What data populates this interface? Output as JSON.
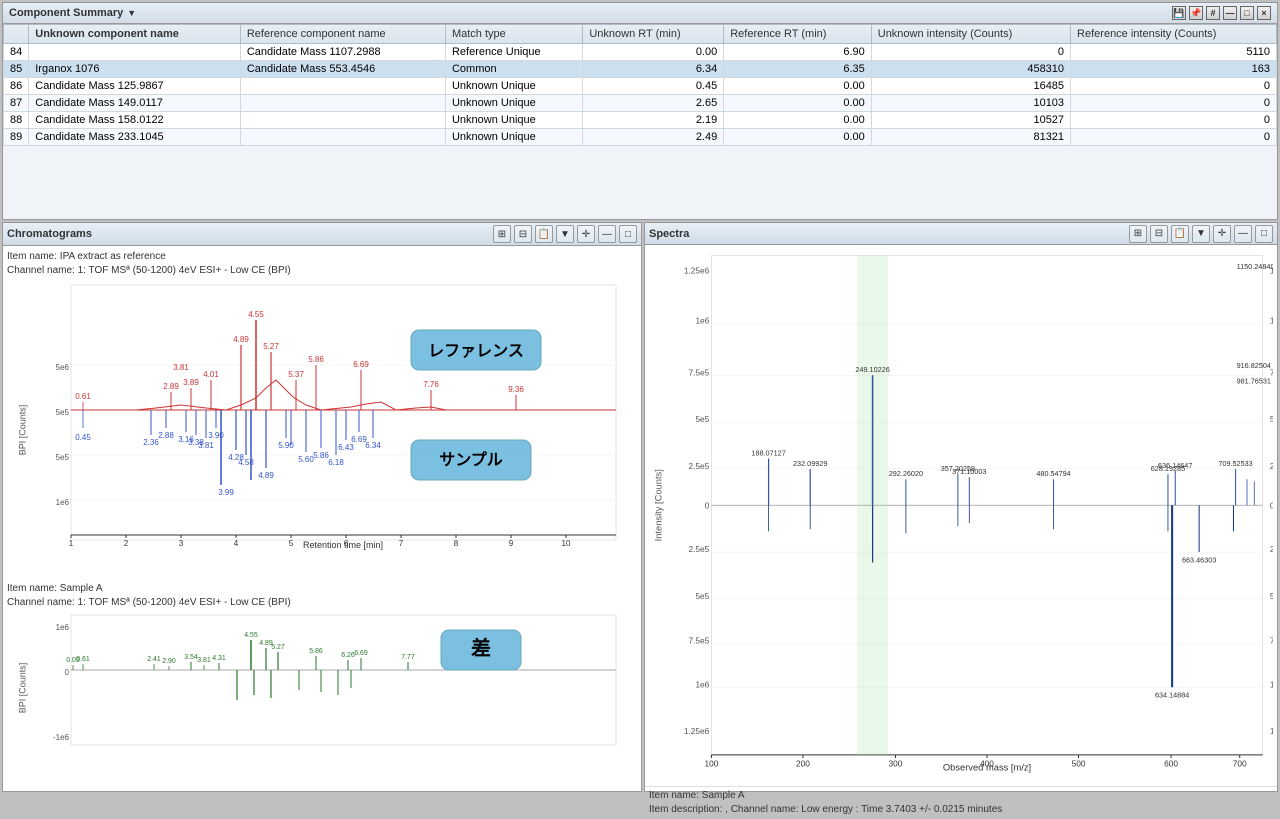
{
  "componentSummary": {
    "title": "Component Summary",
    "columns": [
      "Unknown component name",
      "Reference component name",
      "Match type",
      "Unknown RT (min)",
      "Reference RT (min)",
      "Unknown intensity (Counts)",
      "Reference intensity (Counts)"
    ],
    "rows": [
      {
        "id": 84,
        "unknown": "",
        "reference": "Candidate Mass 1107.2988",
        "match": "Reference Unique",
        "unknownRT": "0.00",
        "refRT": "6.90",
        "unknownInt": "0",
        "refInt": "5110"
      },
      {
        "id": 85,
        "unknown": "Irganox 1076",
        "reference": "Candidate Mass 553.4546",
        "match": "Common",
        "unknownRT": "6.34",
        "refRT": "6.35",
        "unknownInt": "458310",
        "refInt": "163"
      },
      {
        "id": 86,
        "unknown": "Candidate Mass 125.9867",
        "reference": "",
        "match": "Unknown Unique",
        "unknownRT": "0.45",
        "refRT": "0.00",
        "unknownInt": "16485",
        "refInt": "0"
      },
      {
        "id": 87,
        "unknown": "Candidate Mass 149.0117",
        "reference": "",
        "match": "Unknown Unique",
        "unknownRT": "2.65",
        "refRT": "0.00",
        "unknownInt": "10103",
        "refInt": "0"
      },
      {
        "id": 88,
        "unknown": "Candidate Mass 158.0122",
        "reference": "",
        "match": "Unknown Unique",
        "unknownRT": "2.19",
        "refRT": "0.00",
        "unknownInt": "10527",
        "refInt": "0"
      },
      {
        "id": 89,
        "unknown": "Candidate Mass 233.1045",
        "reference": "",
        "match": "Unknown Unique",
        "unknownRT": "2.49",
        "refRT": "0.00",
        "unknownInt": "81321",
        "refInt": "0"
      }
    ]
  },
  "chromatograms": {
    "title": "Chromatograms",
    "itemName": "Item name: IPA extract as reference",
    "channelName": "Channel name: 1: TOF MSª (50-1200) 4eV ESI+ - Low CE (BPI)",
    "sampleItemName": "Item name:  Sample A",
    "sampleChannelName": "Channel name: 1: TOF MSª (50-1200) 4eV ESI+ - Low CE (BPI)",
    "refLabel": "レファレンス",
    "sampleLabel": "サンプル",
    "diffLabel": "差",
    "xAxisLabel": "Retention time [min]",
    "yAxisLabel": "BPI [Counts]",
    "refPeaks": [
      {
        "x": 0.61,
        "label": "0.61"
      },
      {
        "x": 2.89,
        "label": "2.89"
      },
      {
        "x": 3.89,
        "label": "3.89"
      },
      {
        "x": 3.81,
        "label": "3.81"
      },
      {
        "x": 4.01,
        "label": "4.01"
      },
      {
        "x": 4.55,
        "label": "4.55"
      },
      {
        "x": 4.89,
        "label": "4.89"
      },
      {
        "x": 5.27,
        "label": "5.27"
      },
      {
        "x": 5.37,
        "label": "5.37"
      },
      {
        "x": 5.86,
        "label": "5.86"
      },
      {
        "x": 6.69,
        "label": "6.69"
      },
      {
        "x": 7.76,
        "label": "7.76"
      },
      {
        "x": 9.36,
        "label": "9.36"
      }
    ]
  },
  "spectra": {
    "title": "Spectra",
    "xAxisLabel": "Observed mass [m/z]",
    "yAxisLabel": "Intensity [Counts]",
    "itemName": "Item name:  Sample A",
    "itemDesc": "Item description: , Channel name: Low energy : Time 3.7403 +/- 0.0215 minutes",
    "peaks": [
      {
        "x": 188.07127,
        "label": "188.07127"
      },
      {
        "x": 232.09929,
        "label": "232.09929"
      },
      {
        "x": 249.10226,
        "label": "249.10226"
      },
      {
        "x": 292.2602,
        "label": "292.26020"
      },
      {
        "x": 357.20259,
        "label": "357.20259"
      },
      {
        "x": 371.10003,
        "label": "371.10003"
      },
      {
        "x": 480.54794,
        "label": "480.54794"
      },
      {
        "x": 628.19285,
        "label": "628.19285"
      },
      {
        "x": 634.14647,
        "label": "634.14647"
      },
      {
        "x": 634.14884,
        "label": "634.14884"
      },
      {
        "x": 663.46303,
        "label": "663.46303"
      },
      {
        "x": 709.52533,
        "label": "709.52533"
      },
      {
        "x": 916.82504,
        "label": "916.82504"
      },
      {
        "x": 981.76531,
        "label": "981.76531"
      },
      {
        "x": 1150.2484,
        "label": "1150.24840"
      }
    ],
    "yAxisValues": [
      "1.25e6",
      "1e6",
      "7.5e5",
      "5e5",
      "2.5e5",
      "0",
      "2.5e5",
      "5e5",
      "7.5e5",
      "1e6",
      "1.25e6"
    ]
  },
  "toolbar": {
    "saveIcon": "💾",
    "pinIcon": "📌",
    "hashIcon": "#",
    "minimizeIcon": "—",
    "maximizeIcon": "□",
    "closeIcon": "×"
  }
}
